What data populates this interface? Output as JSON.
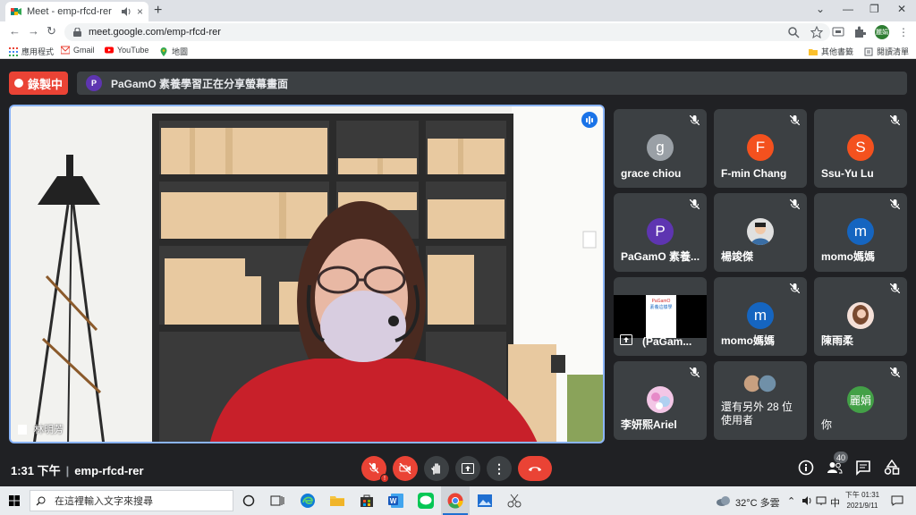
{
  "browser": {
    "tab_title": "Meet - emp-rfcd-rer",
    "tab_close": "×",
    "new_tab": "+",
    "url": "meet.google.com/emp-rfcd-rer",
    "profile_initials": "麗娟",
    "window_controls": [
      "⌄",
      "—",
      "❐",
      "✕"
    ]
  },
  "bookmarks": {
    "items": [
      {
        "label": "應用程式",
        "icon": "apps-grid-icon"
      },
      {
        "label": "Gmail",
        "icon": "gmail-icon"
      },
      {
        "label": "YouTube",
        "icon": "youtube-icon"
      },
      {
        "label": "地圖",
        "icon": "maps-pin-icon"
      }
    ],
    "other_bookmarks": "其他書籤",
    "reading_list": "閱讀清單"
  },
  "meet": {
    "recording_label": "錄製中",
    "presenter_initial": "P",
    "share_banner": "PaGamO 素養學習正在分享螢幕畫面",
    "main_speaker_name": "林明芳",
    "tiles": [
      {
        "name": "grace chiou",
        "initial": "g",
        "color": "#9aa0a6",
        "type": "avatar"
      },
      {
        "name": "F-min Chang",
        "initial": "F",
        "color": "#f4511e",
        "type": "avatar"
      },
      {
        "name": "Ssu-Yu Lu",
        "initial": "S",
        "color": "#f4511e",
        "type": "avatar"
      },
      {
        "name": "PaGamO 素養...",
        "initial": "P",
        "color": "#5e35b1",
        "type": "avatar"
      },
      {
        "name": "楊竣傑",
        "initial": "",
        "color": "#bdbdbd",
        "type": "photo"
      },
      {
        "name": "momo媽媽",
        "initial": "m",
        "color": "#1565c0",
        "type": "avatar"
      },
      {
        "name": "(PaGam...",
        "initial": "",
        "color": "#000000",
        "type": "screen"
      },
      {
        "name": "momo媽媽",
        "initial": "m",
        "color": "#1565c0",
        "type": "avatar"
      },
      {
        "name": "陳雨柔",
        "initial": "",
        "color": "#e0c0b0",
        "type": "photo"
      },
      {
        "name": "李妍熙Ariel",
        "initial": "",
        "color": "#e0a0d0",
        "type": "photo"
      },
      {
        "name": "還有另外 28 位使用者",
        "initial": "",
        "color": "#9aa0a6",
        "type": "others"
      },
      {
        "name": "你",
        "initial": "麗娟",
        "color": "#43a047",
        "type": "avatar"
      }
    ],
    "screen_thumb_title": "PaGamO",
    "screen_thumb_sub": "素養這樣學",
    "time": "1:31 下午",
    "meeting_code": "emp-rfcd-rer",
    "participant_count": "40"
  },
  "taskbar": {
    "search_placeholder": "在這裡輸入文字來搜尋",
    "weather": "32°C 多雲",
    "ime": "中",
    "time": "下午 01:31",
    "date": "2021/9/11"
  }
}
